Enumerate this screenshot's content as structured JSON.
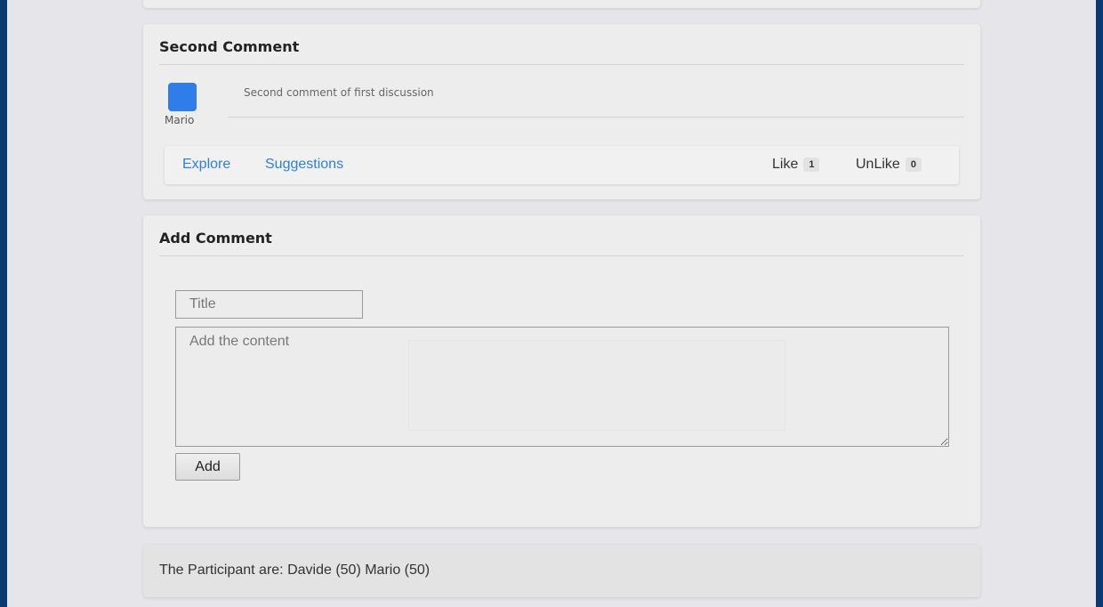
{
  "comment": {
    "title": "Second Comment",
    "author": "Mario",
    "text": "Second comment of first discussion",
    "links": {
      "explore": "Explore",
      "suggestions": "Suggestions"
    },
    "reactions": {
      "like_label": "Like",
      "like_count": "1",
      "unlike_label": "UnLike",
      "unlike_count": "0"
    },
    "avatar_color": "#2e7de9"
  },
  "add_comment": {
    "heading": "Add Comment",
    "title_placeholder": "Title",
    "content_placeholder": "Add the content",
    "submit_label": "Add"
  },
  "participants": {
    "text": "The Participant are: Davide (50) Mario (50)"
  },
  "colors": {
    "outer_background": "#0b3a73",
    "page_background": "#e6e6ea",
    "link": "#2f7fdc"
  }
}
